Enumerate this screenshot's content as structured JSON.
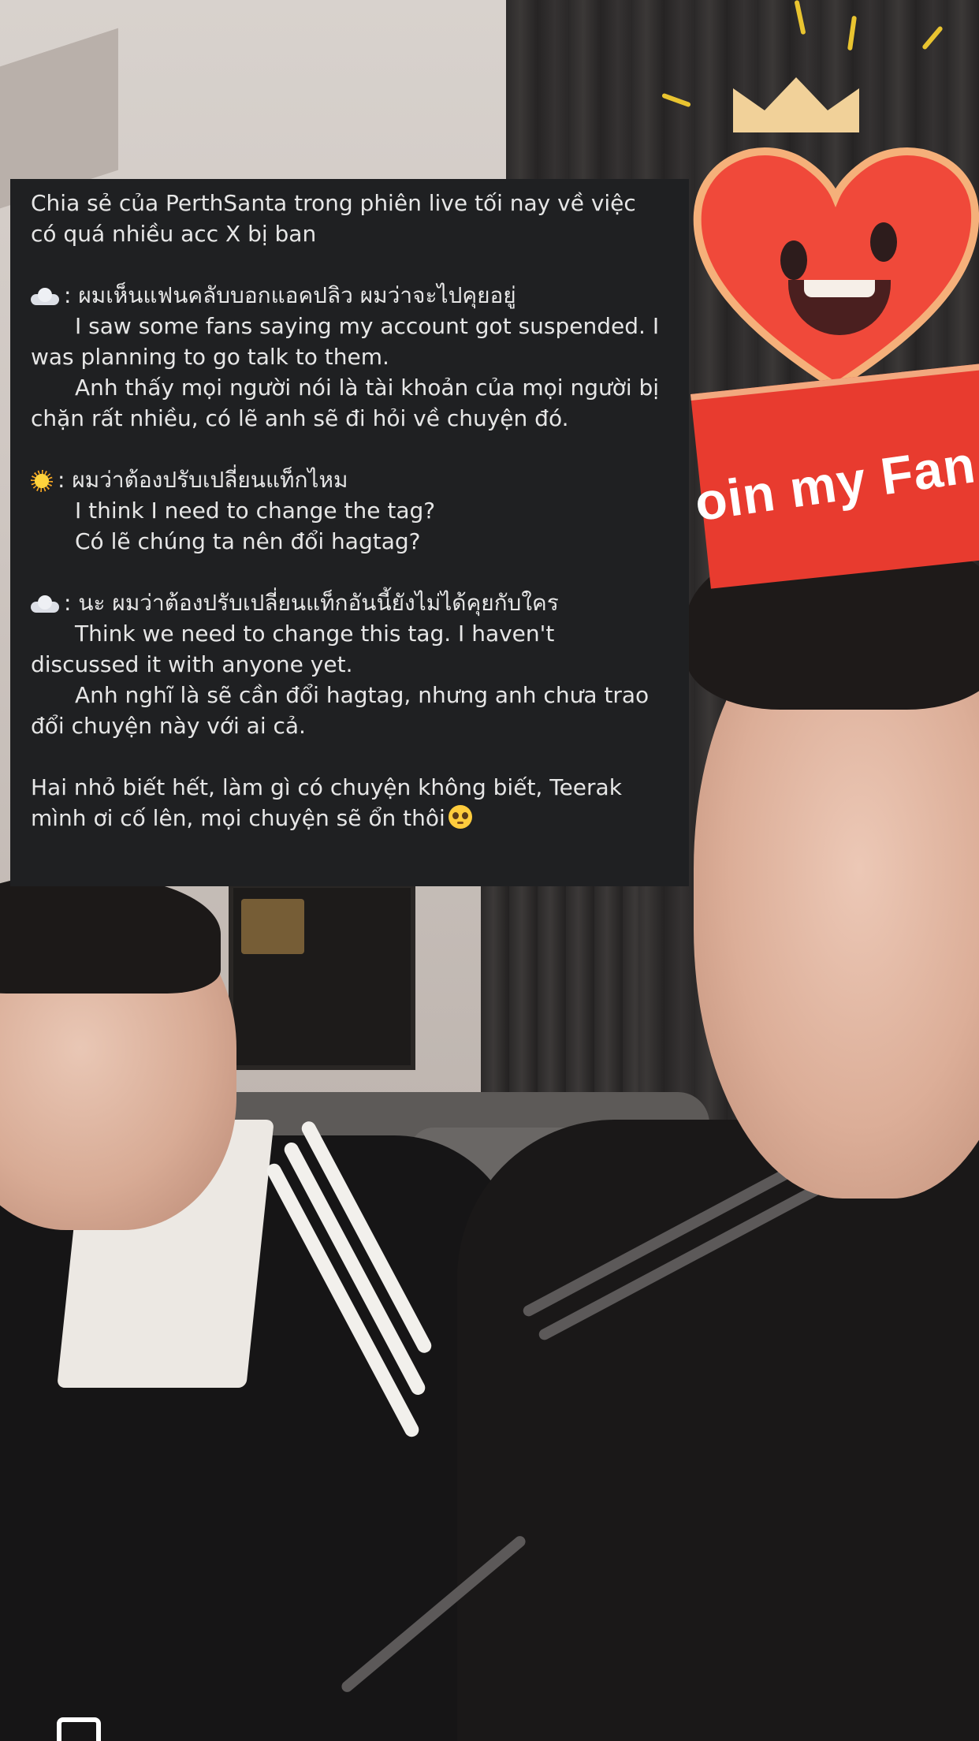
{
  "sticker": {
    "banner_text": "oin my Fan C"
  },
  "overlay": {
    "title_line1": "Chia sẻ của PerthSanta trong phiên live tối nay về việc",
    "title_line2": "có quá nhiều acc X bị ban",
    "blocks": [
      {
        "emoji": "cloud-icon",
        "thai": ": ผมเห็นแฟนคลับบอกแอคปลิว ผมว่าจะไปคุยอยู่",
        "en_line1": "I saw some fans saying my account got suspended. I",
        "en_line2": "was planning to go talk to them.",
        "vi_line1": "Anh thấy mọi người nói là tài khoản của mọi người bị",
        "vi_line2": "chặn rất nhiều, có lẽ anh sẽ đi hỏi về chuyện đó."
      },
      {
        "emoji": "sun-icon",
        "thai": ": ผมว่าต้องปรับเปลี่ยนแท็กไหม",
        "en_line1": "I think I need to change the tag?",
        "vi_line1": "Có lẽ chúng ta nên đổi hagtag?"
      },
      {
        "emoji": "cloud-icon",
        "thai": ": นะ ผมว่าต้องปรับเปลี่ยนแท็กอันนี้ยังไม่ได้คุยกับใคร",
        "en_line1": "Think we need to change this tag. I haven't",
        "en_line2": "discussed it with anyone yet.",
        "vi_line1": "Anh nghĩ là sẽ cần đổi hagtag, nhưng anh chưa trao",
        "vi_line2": "đổi chuyện này với ai cả."
      }
    ],
    "closing_line1": "Hai nhỏ biết hết, làm gì có chuyện không biết, Teerak",
    "closing_line2": "mình ơi cố lên, mọi chuyện sẽ ổn thôi"
  },
  "colors": {
    "card_bg": "#1f2022",
    "card_text": "#e6e6e6",
    "banner_red": "#e83b2f",
    "heart_red": "#f0493a"
  }
}
